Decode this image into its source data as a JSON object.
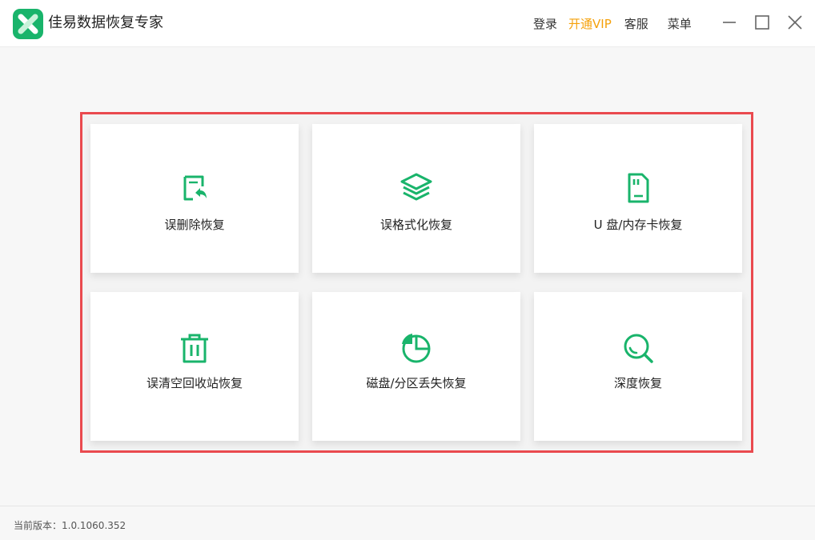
{
  "app": {
    "title": "佳易数据恢复专家",
    "brand_color": "#19b46b"
  },
  "header": {
    "login": "登录",
    "vip": "开通VIP",
    "service": "客服",
    "menu": "菜单",
    "vip_color": "#f5a10b"
  },
  "window_controls": [
    "minimize-icon",
    "maximize-icon",
    "close-icon"
  ],
  "features": [
    {
      "label": "误删除恢复",
      "icon": "file-restore-icon"
    },
    {
      "label": "误格式化恢复",
      "icon": "layers-icon"
    },
    {
      "label": "U 盘/内存卡恢复",
      "icon": "sd-card-icon"
    },
    {
      "label": "误清空回收站恢复",
      "icon": "trash-icon"
    },
    {
      "label": "磁盘/分区丢失恢复",
      "icon": "pie-chart-icon"
    },
    {
      "label": "深度恢复",
      "icon": "deep-search-icon"
    }
  ],
  "highlight_color": "#ea4a4f",
  "footer": {
    "version": "当前版本：1.0.1060.352"
  }
}
